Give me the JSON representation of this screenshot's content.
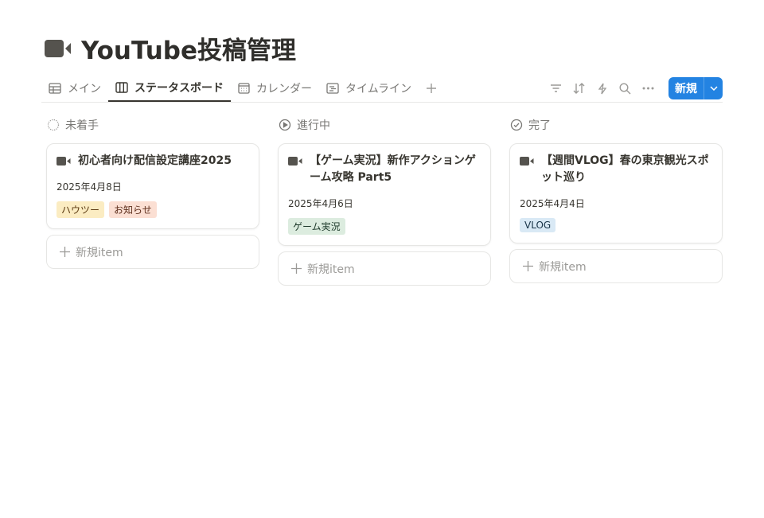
{
  "page": {
    "title": "YouTube投稿管理",
    "icon": "video-camera-icon"
  },
  "tabs": [
    {
      "label": "メイン",
      "icon": "table-icon"
    },
    {
      "label": "ステータスボード",
      "icon": "board-icon",
      "active": true
    },
    {
      "label": "カレンダー",
      "icon": "calendar-icon"
    },
    {
      "label": "タイムライン",
      "icon": "timeline-icon"
    }
  ],
  "toolbar": {
    "new_label": "新規"
  },
  "colors": {
    "accent": "#2383e2"
  },
  "columns": [
    {
      "label": "未着手",
      "icon": "dotted-circle-icon",
      "cards": [
        {
          "title": "初心者向け配信設定講座2025",
          "date": "2025年4月8日",
          "tags": [
            {
              "label": "ハウツー",
              "bg": "#fbecc2",
              "fg": "#5c3b12"
            },
            {
              "label": "お知らせ",
              "bg": "#fbdfd3",
              "fg": "#5d2e1c"
            }
          ]
        }
      ],
      "add_label": "新規item"
    },
    {
      "label": "進行中",
      "icon": "play-circle-icon",
      "cards": [
        {
          "title": "【ゲーム実況】新作アクションゲーム攻略 Part5",
          "date": "2025年4月6日",
          "tags": [
            {
              "label": "ゲーム実況",
              "bg": "#dcecdf",
              "fg": "#1c3829"
            }
          ]
        }
      ],
      "add_label": "新規item"
    },
    {
      "label": "完了",
      "icon": "check-circle-icon",
      "cards": [
        {
          "title": "【週間VLOG】春の東京観光スポット巡り",
          "date": "2025年4月4日",
          "tags": [
            {
              "label": "VLOG",
              "bg": "#d9e9f5",
              "fg": "#183347"
            }
          ]
        }
      ],
      "add_label": "新規item"
    }
  ]
}
